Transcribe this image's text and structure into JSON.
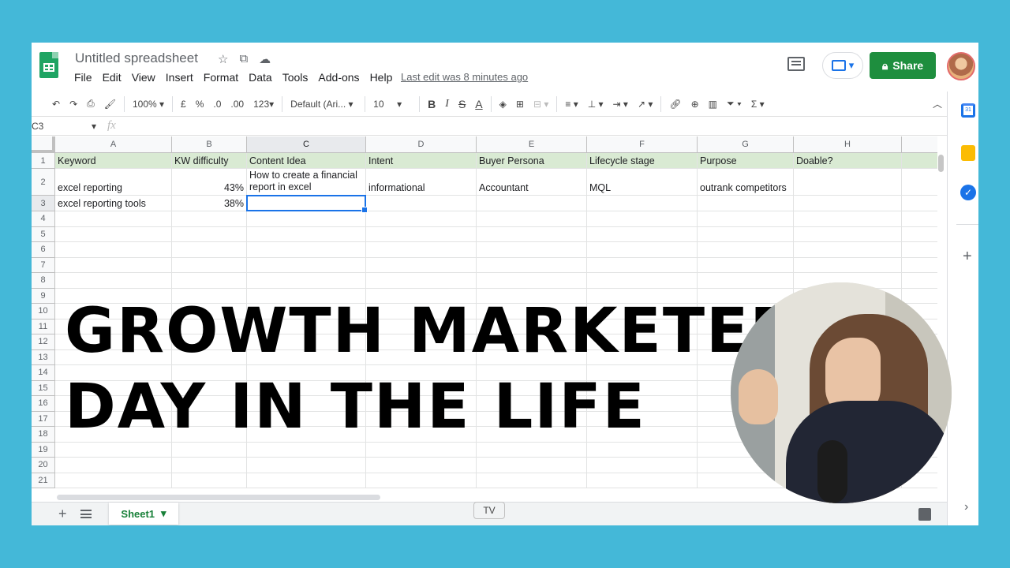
{
  "header": {
    "title": "Untitled spreadsheet",
    "menu": [
      "File",
      "Edit",
      "View",
      "Insert",
      "Format",
      "Data",
      "Tools",
      "Add-ons",
      "Help"
    ],
    "last_edit": "Last edit was 8 minutes ago",
    "share_label": "Share"
  },
  "toolbar": {
    "zoom": "100%",
    "currency": "£",
    "percent": "%",
    "dec_decrease": ".0",
    "dec_increase": ".00",
    "more_formats": "123",
    "font": "Default (Ari...",
    "font_size": "10",
    "bold": "B",
    "italic": "I",
    "strike": "S",
    "text_color": "A"
  },
  "formula_bar": {
    "name_box": "C3",
    "fx": "fx"
  },
  "grid": {
    "columns": [
      "A",
      "B",
      "C",
      "D",
      "E",
      "F",
      "G",
      "H"
    ],
    "rows": [
      "1",
      "2",
      "3",
      "4",
      "5",
      "6",
      "7",
      "8",
      "9",
      "10",
      "11",
      "12",
      "13",
      "14",
      "15",
      "16",
      "17",
      "18",
      "19",
      "20",
      "21"
    ],
    "header_row": [
      "Keyword",
      "KW difficulty",
      "Content Idea",
      "Intent",
      "Buyer Persona",
      "Lifecycle stage",
      "Purpose",
      "Doable?"
    ],
    "row2": [
      "excel reporting",
      "43%",
      "How to create a financial report in excel",
      "informational",
      "Accountant",
      "MQL",
      "outrank competitors",
      ""
    ],
    "row3": [
      "excel reporting tools",
      "38%",
      "",
      "",
      "",
      "",
      "",
      ""
    ],
    "header_color": "#d9ead3",
    "selection_color": "#1a73e8"
  },
  "sheets": {
    "active": "Sheet1",
    "tv_badge": "TV"
  },
  "overlay": {
    "line1": "GROWTH MARKETER",
    "line2": "DAY IN THE LIFE"
  },
  "colors": {
    "background": "#44b8d8",
    "share_button": "#1e8e3e",
    "sheet_tab_text": "#188038"
  },
  "icons": {
    "star": "star-icon",
    "move": "move-to-folder-icon",
    "cloud": "cloud-status-icon",
    "comment": "comment-icon",
    "present": "present-icon",
    "lock": "lock-icon"
  }
}
